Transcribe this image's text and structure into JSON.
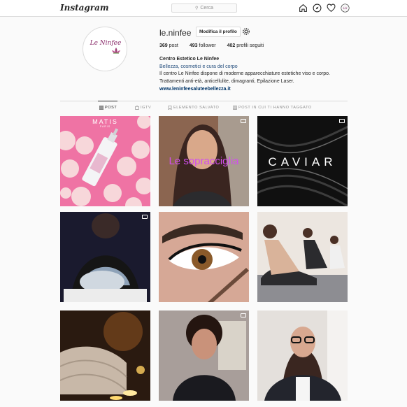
{
  "topbar": {
    "logo": "Instagram",
    "search_placeholder": "Cerca",
    "icons": [
      "home-icon",
      "explore-icon",
      "heart-icon",
      "profile-icon"
    ]
  },
  "profile": {
    "pic_text": "Le Ninfee",
    "username": "le.ninfee",
    "edit_label": "Modifica il profilo",
    "stats": {
      "posts_count": "369",
      "posts_label": "post",
      "followers_count": "493",
      "followers_label": "follower",
      "following_count": "402",
      "following_label": "profili seguiti"
    },
    "bio": {
      "name": "Centro Estetico Le Ninfee",
      "category": "Bellezza, cosmetici e cura del corpo",
      "line1": "Il centro Le Ninfee dispone di moderne apparecchiature estetiche viso e corpo.",
      "line2": "Trattamenti anti-età, anticellulite, dimagranti, Epilazione Laser.",
      "link": "www.leninfeesaluteebellezza.it"
    }
  },
  "tabs": [
    {
      "label": "POST",
      "icon": "grid-icon",
      "active": true
    },
    {
      "label": "IGTV",
      "icon": "igtv-icon",
      "active": false
    },
    {
      "label": "ELEMENTO SALVATO",
      "icon": "bookmark-icon",
      "active": false
    },
    {
      "label": "POST IN CUI TI HANNO TAGGATO",
      "icon": "tagged-icon",
      "active": false
    }
  ],
  "posts": {
    "p1_text": "MATIS",
    "p1_sub": "PARIS",
    "p2_text": "Le sopracciglia",
    "p3_text": "CAVIAR"
  },
  "colors": {
    "accent_link": "#003569",
    "category": "#1f4a7a",
    "border": "#dbdbdb",
    "brand": "#8a2b6a"
  }
}
